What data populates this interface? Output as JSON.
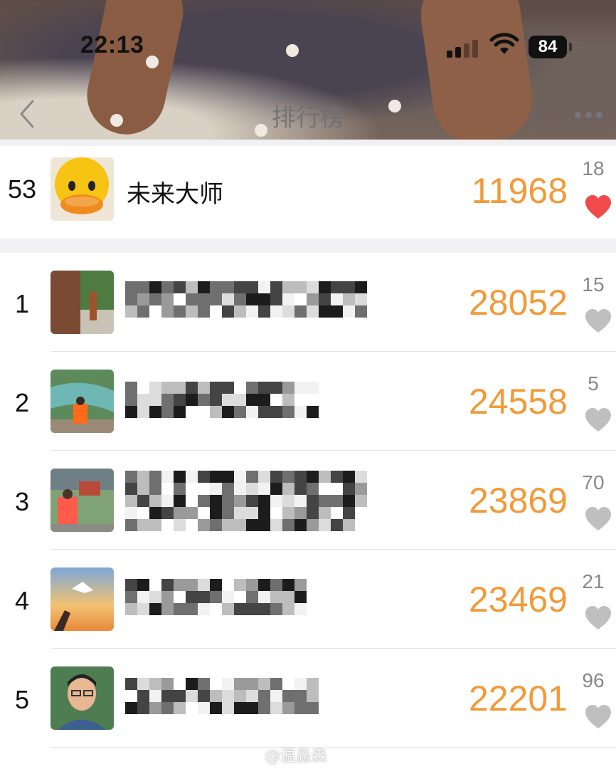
{
  "status_bar": {
    "time": "22:13",
    "battery": "84"
  },
  "nav": {
    "title": "排行榜"
  },
  "my_entry": {
    "rank": "53",
    "name": "未来大师",
    "steps": "11968",
    "likes": "18",
    "liked": true
  },
  "entries": [
    {
      "rank": "1",
      "steps": "28052",
      "likes": "15"
    },
    {
      "rank": "2",
      "steps": "24558",
      "likes": "5"
    },
    {
      "rank": "3",
      "steps": "23869",
      "likes": "70"
    },
    {
      "rank": "4",
      "steps": "23469",
      "likes": "21"
    },
    {
      "rank": "5",
      "steps": "22201",
      "likes": "96"
    }
  ],
  "watermark": "@温淼森",
  "colors": {
    "steps": "#f29a38",
    "heart_active": "#f04a4a",
    "heart_inactive": "#bfbfbf"
  },
  "icons": {
    "back": "chevron-left-icon",
    "more": "more-dots-icon",
    "like": "heart-icon"
  }
}
